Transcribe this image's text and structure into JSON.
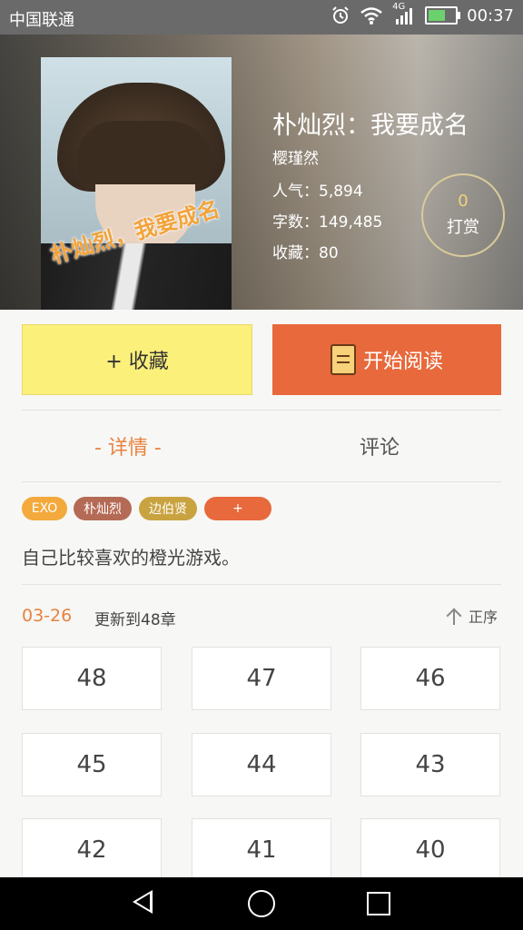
{
  "status_bar": {
    "carrier": "中国联通",
    "network": "4G",
    "time": "00:37",
    "icons": [
      "alarm-icon",
      "wifi-icon",
      "signal-icon",
      "battery-icon"
    ]
  },
  "book": {
    "title": "朴灿烈：我要成名",
    "cover_text": "朴灿烈，我要成名",
    "author": "樱瑾然",
    "popularity": "人气：5,894",
    "word_count": "字数：149,485",
    "favorites": "收藏：80"
  },
  "reward": {
    "count": "0",
    "label": "打赏"
  },
  "actions": {
    "collect": "+ 收藏",
    "read": "开始阅读"
  },
  "tabs": {
    "details": "- 详情 -",
    "comments": "评论"
  },
  "tags": [
    "EXO",
    "朴灿烈",
    "边伯贤",
    "+"
  ],
  "description": "自己比较喜欢的橙光游戏。",
  "update": {
    "date": "03-26",
    "text": "更新到48章",
    "sort_label": "正序"
  },
  "chapters": [
    "48",
    "47",
    "46",
    "45",
    "44",
    "43",
    "42",
    "41",
    "40"
  ],
  "colors": {
    "accent": "#e8693c",
    "highlight": "#e8823e",
    "collect_bg": "#fbf07a"
  }
}
